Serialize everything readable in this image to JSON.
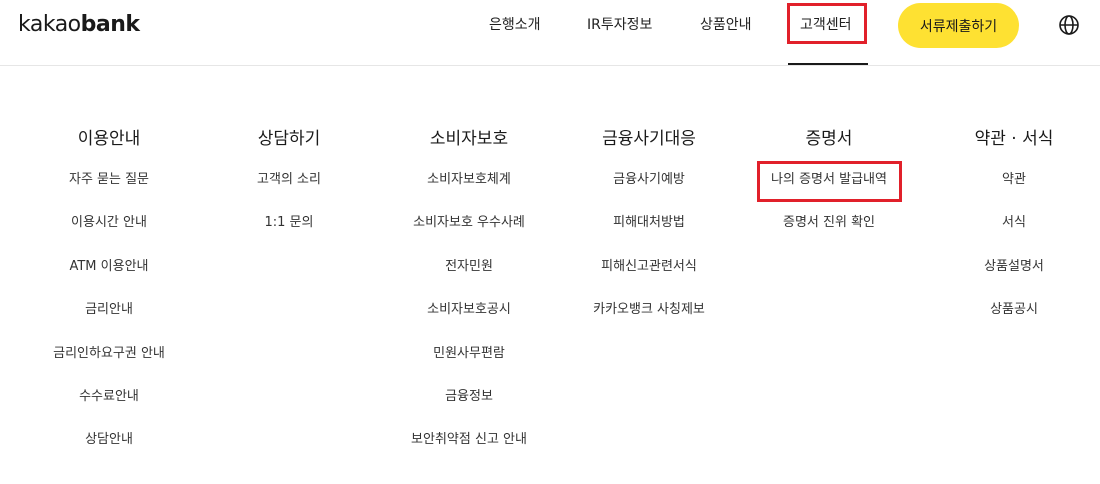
{
  "logo": {
    "part1": "kakao",
    "part2": "bank"
  },
  "nav": {
    "items": [
      {
        "label": "은행소개"
      },
      {
        "label": "IR투자정보"
      },
      {
        "label": "상품안내"
      },
      {
        "label": "고객센터"
      }
    ],
    "cta_label": "서류제출하기",
    "globe_icon": "globe-icon"
  },
  "colors": {
    "accent_yellow": "#fee132",
    "highlight_red": "#e1202a"
  },
  "menu": {
    "columns": [
      {
        "title": "이용안내",
        "items": [
          "자주 묻는 질문",
          "이용시간 안내",
          "ATM 이용안내",
          "금리안내",
          "금리인하요구권 안내",
          "수수료안내",
          "상담안내"
        ]
      },
      {
        "title": "상담하기",
        "items": [
          "고객의 소리",
          "1:1 문의"
        ]
      },
      {
        "title": "소비자보호",
        "items": [
          "소비자보호체계",
          "소비자보호 우수사례",
          "전자민원",
          "소비자보호공시",
          "민원사무편람",
          "금융정보",
          "보안취약점 신고 안내"
        ]
      },
      {
        "title": "금융사기대응",
        "items": [
          "금융사기예방",
          "피해대처방법",
          "피해신고관련서식",
          "카카오뱅크 사칭제보"
        ]
      },
      {
        "title": "증명서",
        "items": [
          "나의 증명서 발급내역",
          "증명서 진위 확인"
        ]
      },
      {
        "title": "약관 · 서식",
        "items": [
          "약관",
          "서식",
          "상품설명서",
          "상품공시"
        ]
      }
    ]
  }
}
